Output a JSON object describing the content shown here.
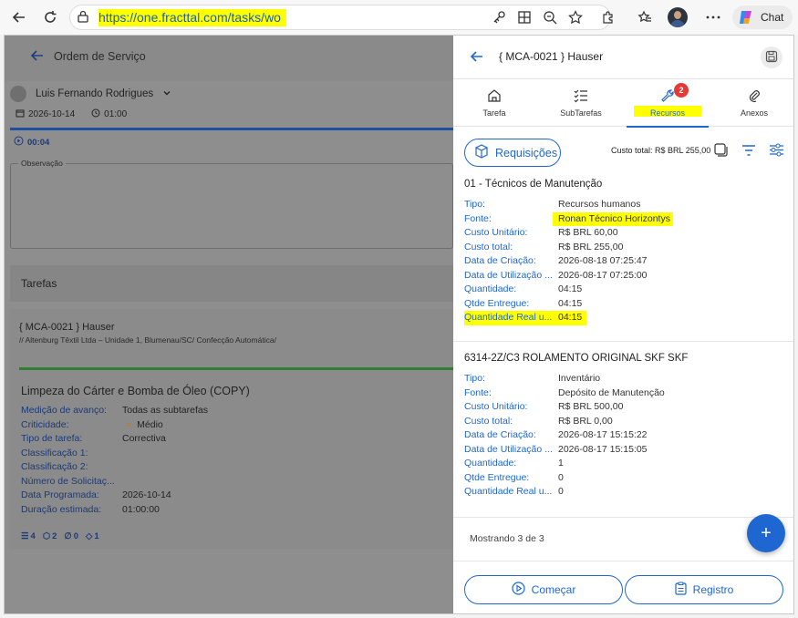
{
  "browser": {
    "url": "https://one.fracttal.com/tasks/wo",
    "chat_label": "Chat"
  },
  "left_panel": {
    "title": "Ordem de Serviço",
    "user": "Luis Fernando Rodrigues",
    "date": "2026-10-14",
    "time": "01:00",
    "timer": "00:04",
    "observation_label": "Observação",
    "tasks_title": "Tarefas",
    "task_asset": "{ MCA-0021 } Hauser",
    "task_path": "// Altenburg Têxtil Ltda – Unidade 1, Blumenau/SC/ Confecção Automática/",
    "task_name": "Limpeza do Cárter e Bomba de Óleo (COPY)",
    "fields": [
      {
        "label": "Medição de avanço:",
        "value": "Todas as subtarefas"
      },
      {
        "label": "Criticidade:",
        "value": "Médio",
        "icon": "="
      },
      {
        "label": "Tipo de tarefa:",
        "value": "Correctiva"
      },
      {
        "label": "Classificação 1:",
        "value": ""
      },
      {
        "label": "Classificação 2:",
        "value": ""
      },
      {
        "label": "Número de Solicitaç...",
        "value": ""
      },
      {
        "label": "Data Programada:",
        "value": "2026-10-14"
      },
      {
        "label": "Duração estimada:",
        "value": "01:00:00"
      }
    ],
    "stats": {
      "subtasks": "4",
      "resources": "2",
      "attachments": "0",
      "other": "1"
    }
  },
  "right_panel": {
    "title": "{ MCA-0021 } Hauser",
    "tabs": [
      {
        "label": "Tarefa"
      },
      {
        "label": "SubTarefas"
      },
      {
        "label": "Recursos",
        "badge": "2"
      },
      {
        "label": "Anexos"
      }
    ],
    "requisicoes_label": "Requisições",
    "custo_total": "Custo total: R$ BRL 255,00",
    "resources": [
      {
        "title": "01 - Técnicos de Manutenção",
        "rows": [
          {
            "k": "Tipo:",
            "v": "Recursos humanos"
          },
          {
            "k": "Fonte:",
            "v": "Ronan Técnico Horizontys"
          },
          {
            "k": "Custo Unitário:",
            "v": "R$ BRL 60,00"
          },
          {
            "k": "Custo total:",
            "v": "R$ BRL 255,00"
          },
          {
            "k": "Data de Criação:",
            "v": "2026-08-18 07:25:47"
          },
          {
            "k": "Data de Utilização ...",
            "v": "2026-08-17 07:25:00"
          },
          {
            "k": "Quantidade:",
            "v": "04:15"
          },
          {
            "k": "Qtde Entregue:",
            "v": "04:15"
          },
          {
            "k": "Quantidade Real u...",
            "v": "04:15"
          }
        ]
      },
      {
        "title": "6314-2Z/C3 ROLAMENTO ORIGINAL SKF SKF",
        "rows": [
          {
            "k": "Tipo:",
            "v": "Inventário"
          },
          {
            "k": "Fonte:",
            "v": "Depósito de Manutenção"
          },
          {
            "k": "Custo Unitário:",
            "v": "R$ BRL 500,00"
          },
          {
            "k": "Custo total:",
            "v": "R$ BRL 0,00"
          },
          {
            "k": "Data de Criação:",
            "v": "2026-08-17 15:15:22"
          },
          {
            "k": "Data de Utilização ...",
            "v": "2026-08-17 15:15:05"
          },
          {
            "k": "Quantidade:",
            "v": "1"
          },
          {
            "k": "Qtde Entregue:",
            "v": "0"
          },
          {
            "k": "Quantidade Real u...",
            "v": "0"
          }
        ]
      }
    ],
    "showing": "Mostrando 3 de 3",
    "start_label": "Começar",
    "register_label": "Registro"
  }
}
